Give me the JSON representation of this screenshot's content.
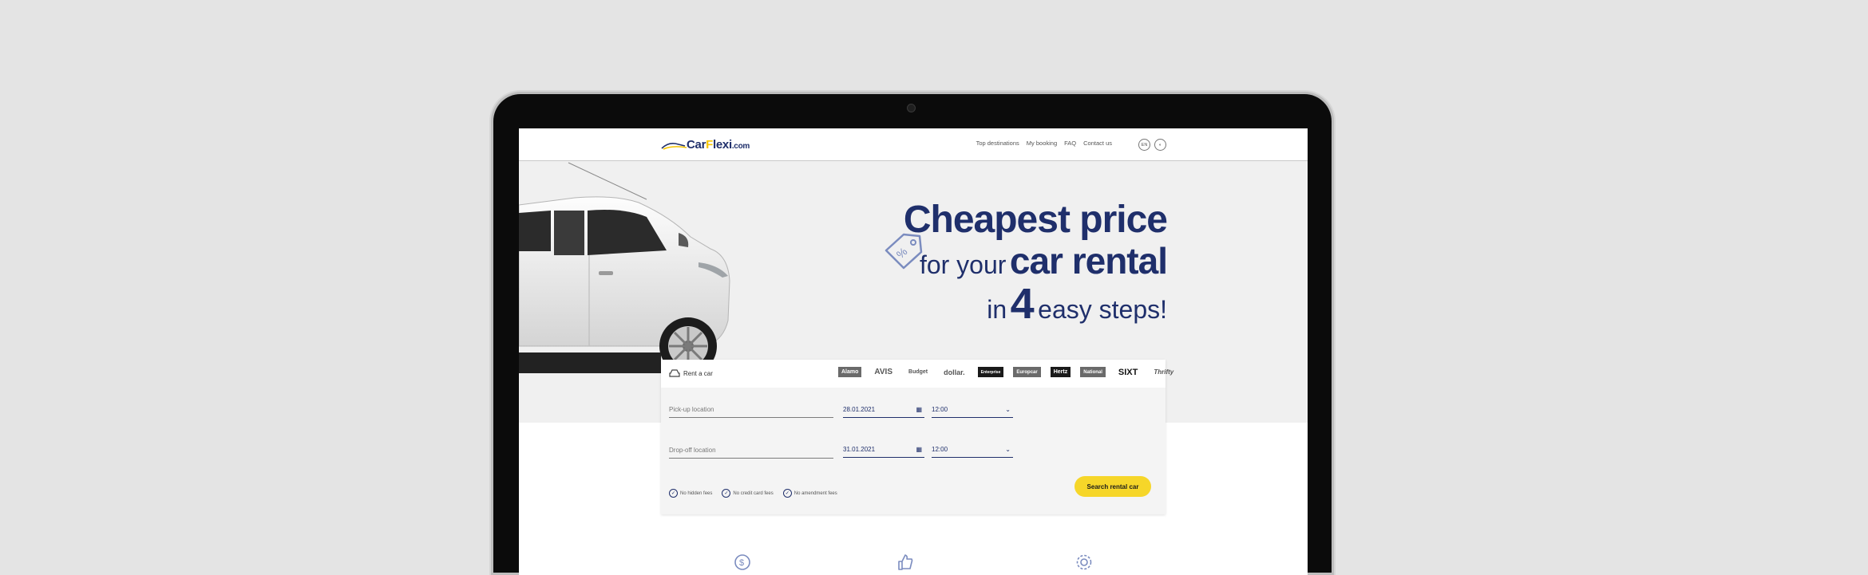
{
  "brand": {
    "name_pre": "Car",
    "name_mid": "F",
    "name_post": "lexi",
    "tld": ".com"
  },
  "nav": {
    "links": [
      "Top destinations",
      "My booking",
      "FAQ",
      "Contact us"
    ],
    "lang": "EN",
    "theme_icon": "half-moon-icon"
  },
  "hero": {
    "line1": "Cheapest price",
    "line2_small": "for your",
    "line2_big": "car rental",
    "line3_small_a": "in",
    "line3_big": "4",
    "line3_small_b": "easy steps!",
    "tag_icon": "discount-tag-icon"
  },
  "search": {
    "title": "Rent a car",
    "partners": [
      "Alamo",
      "AVIS",
      "Budget",
      "dollar.",
      "Enterprise",
      "Europcar",
      "Hertz",
      "National",
      "SIXT",
      "Thrifty"
    ],
    "pickup_placeholder": "Pick-up location",
    "pickup_date": "28.01.2021",
    "pickup_time": "12:00",
    "dropoff_placeholder": "Drop-off location",
    "dropoff_date": "31.01.2021",
    "dropoff_time": "12:00",
    "perks": [
      "No hidden fees",
      "No credit card fees",
      "No amendment fees"
    ],
    "button": "Search rental car"
  },
  "colors": {
    "navy": "#1f2f6b",
    "yellow": "#f6d629",
    "hero_bg": "#f0f0f0"
  }
}
